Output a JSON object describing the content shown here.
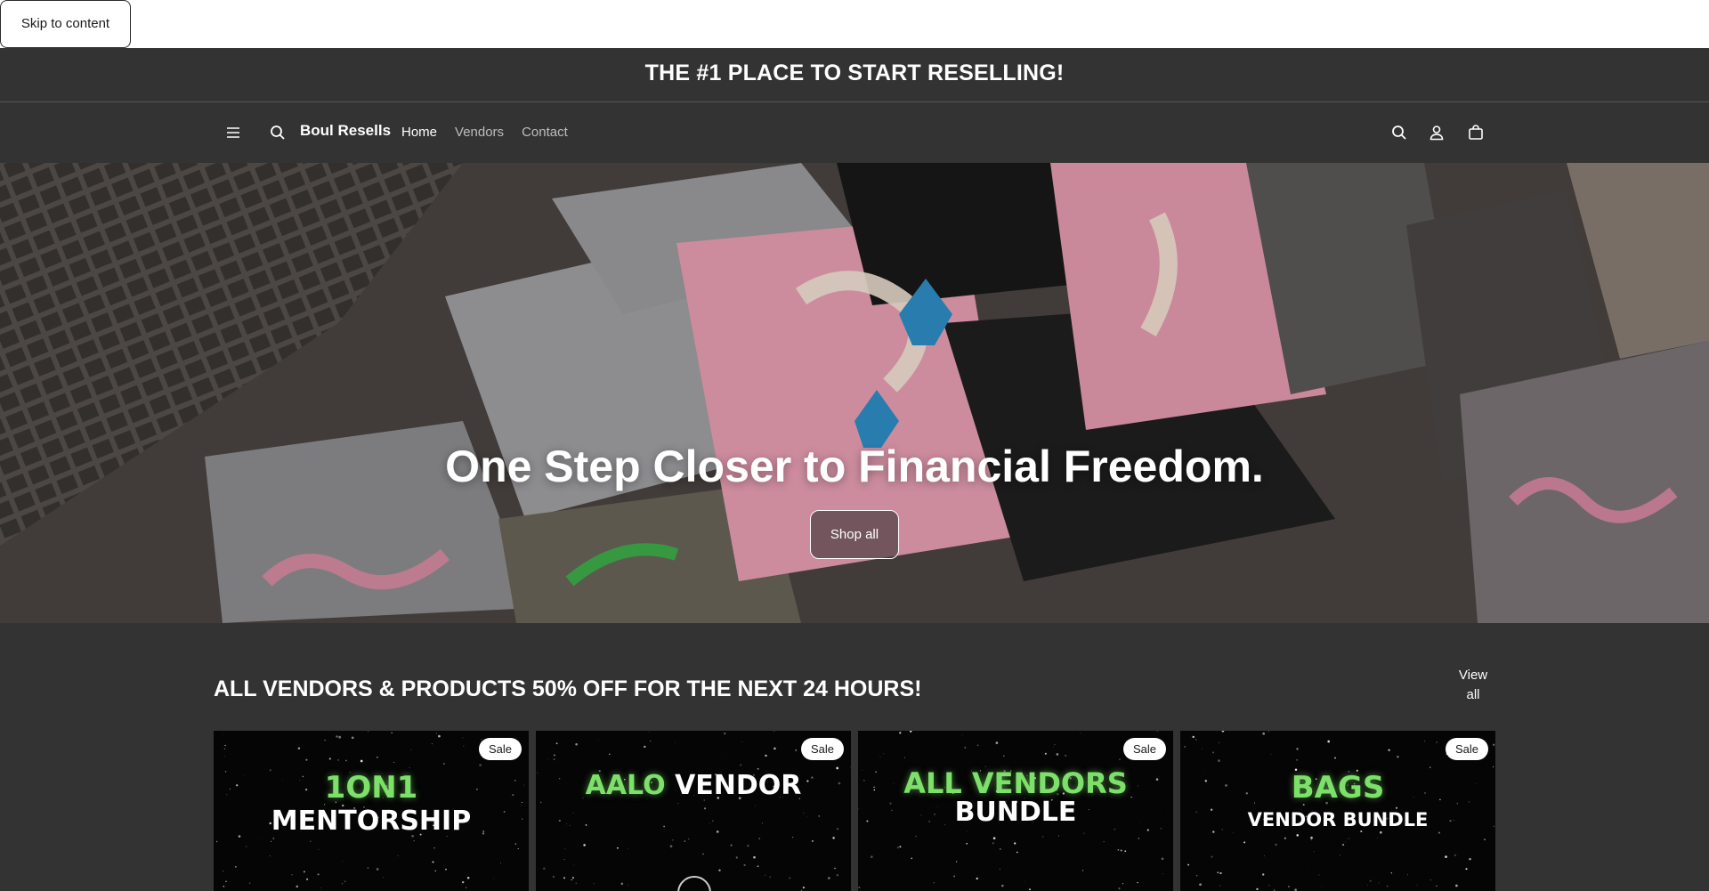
{
  "skip_link": "Skip to content",
  "announcement": "THE #1 PLACE TO START RESELLING!",
  "header": {
    "brand": "Boul Resells",
    "nav": [
      "Home",
      "Vendors",
      "Contact"
    ]
  },
  "hero": {
    "title": "One Step Closer to Financial Freedom.",
    "cta": "Shop all"
  },
  "collection": {
    "title": "ALL VENDORS & PRODUCTS 50% OFF FOR THE NEXT 24 HOURS!",
    "view_all_1": "View",
    "view_all_2": "all",
    "products": [
      {
        "badge": "Sale",
        "line1": "1ON1",
        "line2": "MENTORSHIP"
      },
      {
        "badge": "Sale",
        "line1": "AALO",
        "line1b": "VENDOR"
      },
      {
        "badge": "Sale",
        "line1": "ALL VENDORS",
        "line2": "BUNDLE"
      },
      {
        "badge": "Sale",
        "line1": "BAGS",
        "line2": "VENDOR BUNDLE"
      }
    ]
  },
  "colors": {
    "background": "#333333",
    "accent_green": "#7de06a",
    "badge_bg": "#ffffff"
  },
  "icons": [
    "menu-icon",
    "search-icon",
    "account-icon",
    "cart-icon"
  ]
}
